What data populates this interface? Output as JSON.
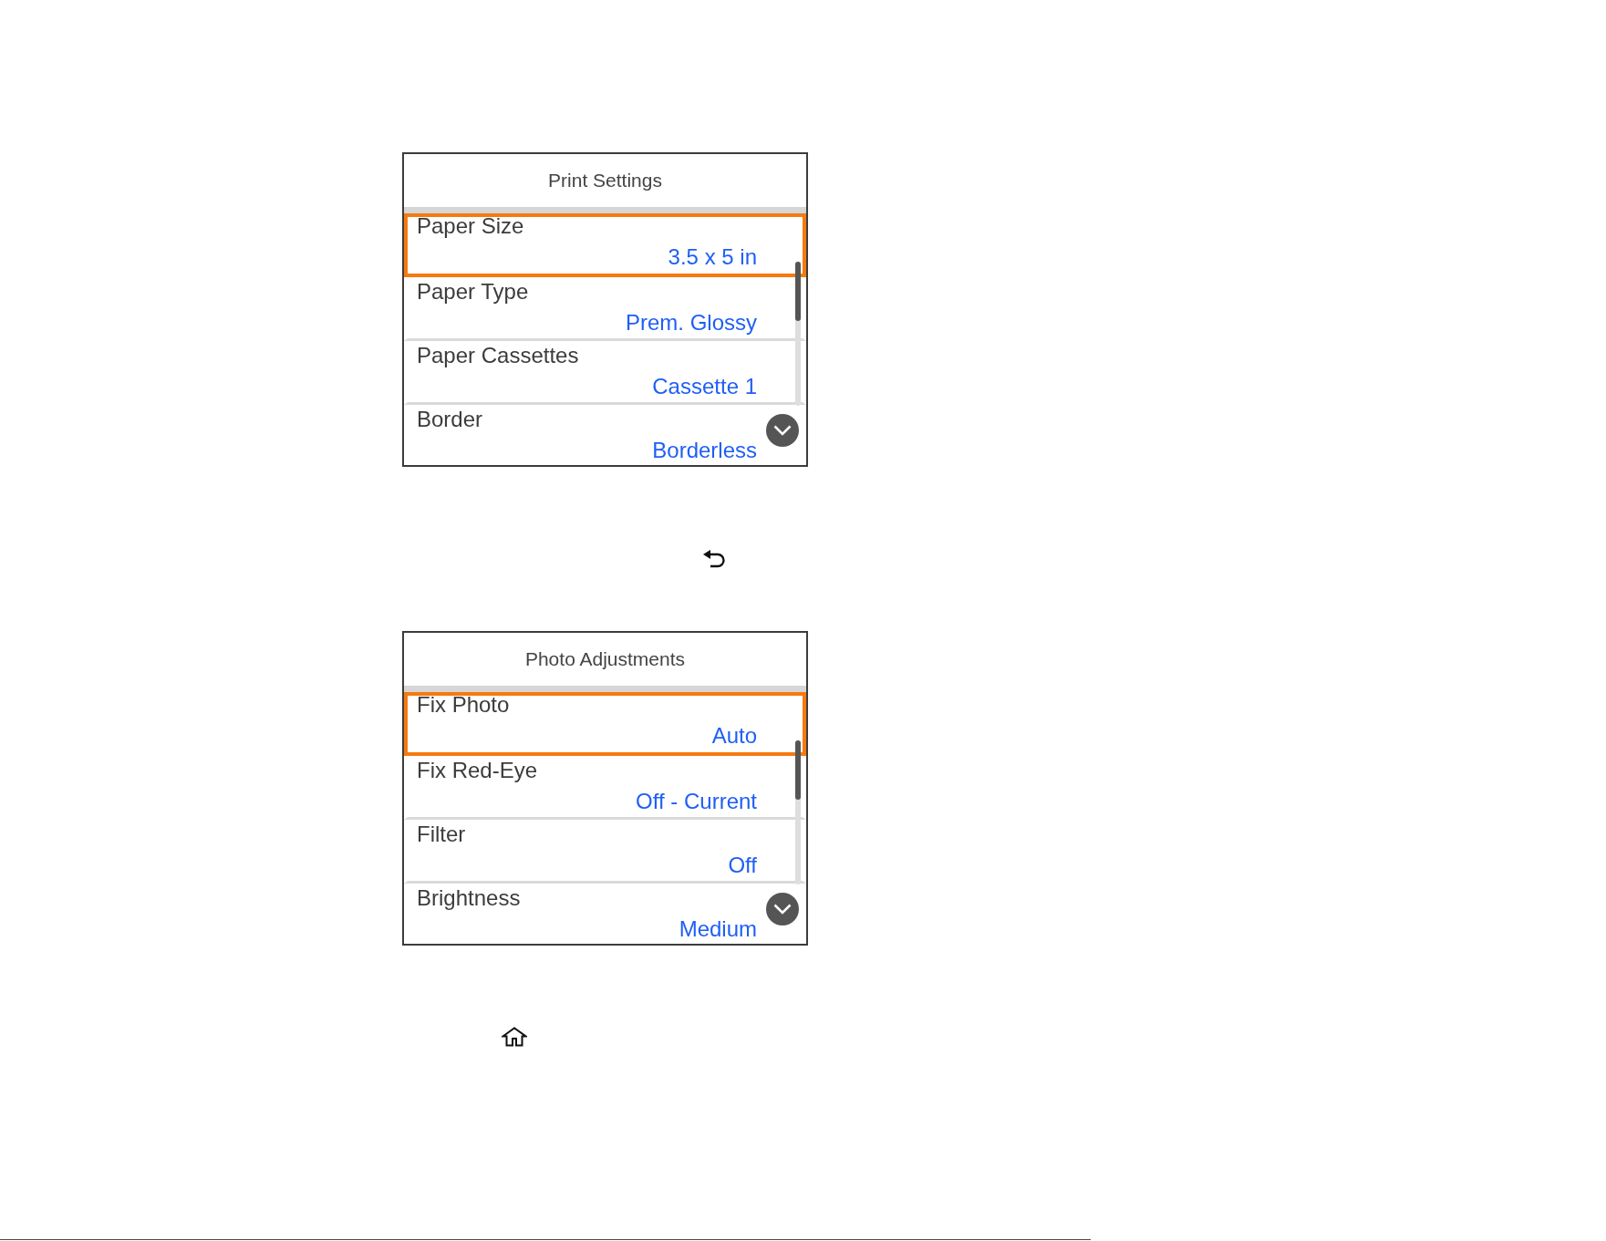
{
  "screens": [
    {
      "title": "Print Settings",
      "items": [
        {
          "label": "Paper Size",
          "value": "3.5 x 5 in",
          "selected": true
        },
        {
          "label": "Paper Type",
          "value": "Prem. Glossy",
          "selected": false
        },
        {
          "label": "Paper Cassettes",
          "value": "Cassette 1",
          "selected": false
        },
        {
          "label": "Border",
          "value": "Borderless",
          "selected": false
        }
      ]
    },
    {
      "title": "Photo Adjustments",
      "items": [
        {
          "label": "Fix Photo",
          "value": "Auto",
          "selected": true
        },
        {
          "label": "Fix Red-Eye",
          "value": "Off - Current",
          "selected": false
        },
        {
          "label": "Filter",
          "value": "Off",
          "selected": false
        },
        {
          "label": "Brightness",
          "value": "Medium",
          "selected": false
        }
      ]
    }
  ]
}
